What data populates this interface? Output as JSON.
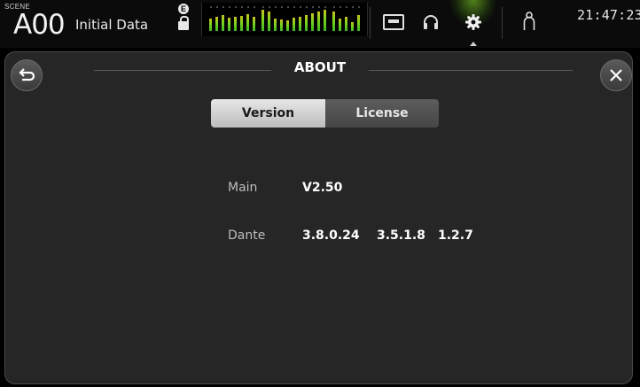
{
  "topbar": {
    "scene_label": "SCENE",
    "scene_number": "A00",
    "scene_name": "Initial Data",
    "lock_letter": "E",
    "clock": "21:47:23",
    "icons": [
      "lock-icon",
      "cassette-icon",
      "headphone-icon",
      "gear-icon",
      "user-icon"
    ],
    "accent_color": "#7ed321"
  },
  "dialog": {
    "title": "ABOUT",
    "back_icon": "back-arrow-icon",
    "close_icon": "close-icon",
    "tabs": [
      {
        "label": "Version",
        "active": true
      },
      {
        "label": "License",
        "active": false
      }
    ],
    "rows": [
      {
        "label": "Main",
        "values": [
          "V2.50"
        ]
      },
      {
        "label": "Dante",
        "values": [
          "3.8.0.24",
          "3.5.1.8",
          "1.2.7"
        ]
      }
    ]
  }
}
